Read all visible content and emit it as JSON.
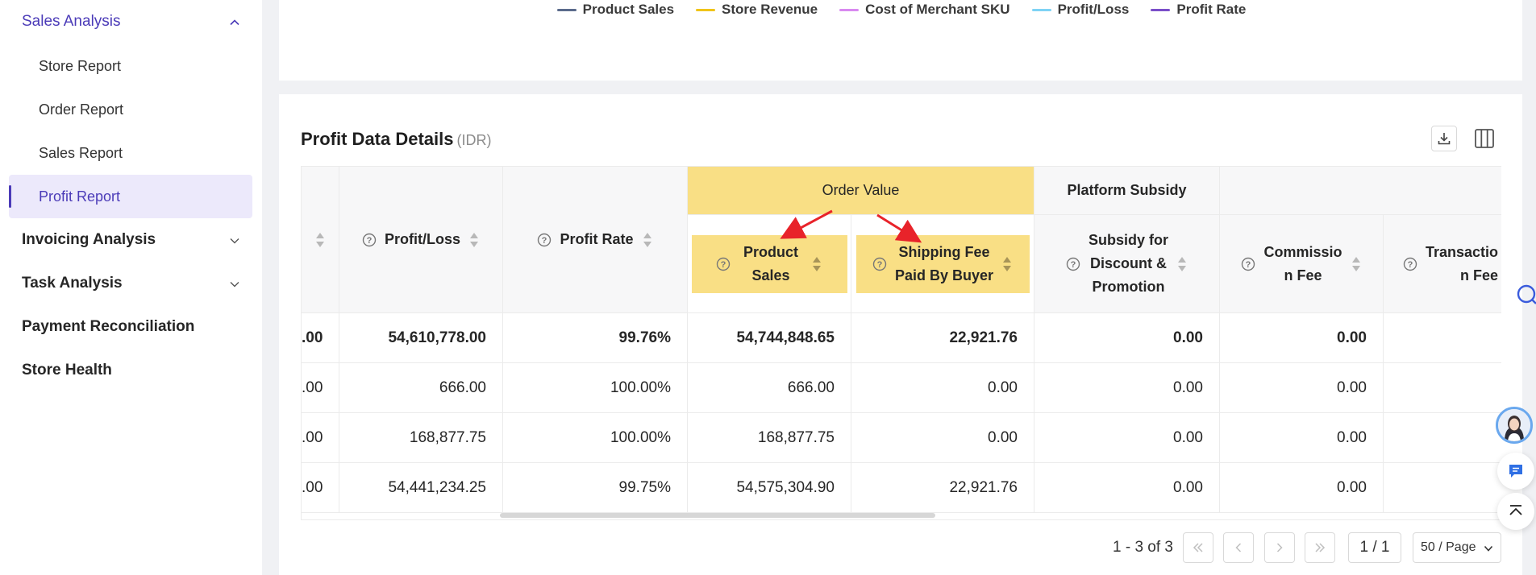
{
  "sidebar": {
    "groups": [
      {
        "label": "Sales Analysis",
        "expanded": true,
        "sub": [
          "Store Report",
          "Order Report",
          "Sales Report",
          "Profit Report"
        ],
        "selected": "Profit Report"
      },
      {
        "label": "Invoicing Analysis",
        "expanded": false
      },
      {
        "label": "Task Analysis",
        "expanded": false
      },
      {
        "label": "Payment Reconciliation"
      },
      {
        "label": "Store Health"
      }
    ]
  },
  "legend": {
    "items": [
      {
        "label": "Product Sales",
        "color": "#5b6b8c"
      },
      {
        "label": "Store Revenue",
        "color": "#f0c419"
      },
      {
        "label": "Cost of Merchant SKU",
        "color": "#d98af0"
      },
      {
        "label": "Profit/Loss",
        "color": "#7fd3f5"
      },
      {
        "label": "Profit Rate",
        "color": "#7b4fc9"
      }
    ]
  },
  "details": {
    "title": "Profit Data Details",
    "unit": "(IDR)",
    "group_headers": {
      "order_value": "Order Value",
      "platform_subsidy": "Platform Subsidy"
    },
    "columns": {
      "profit_loss": "Profit/Loss",
      "profit_rate": "Profit Rate",
      "product_sales_l1": "Product",
      "product_sales_l2": "Sales",
      "shipping_l1": "Shipping Fee",
      "shipping_l2": "Paid By Buyer",
      "subsidy_l1": "Subsidy for",
      "subsidy_l2": "Discount &",
      "subsidy_l3": "Promotion",
      "commission_l1": "Commissio",
      "commission_l2": "n Fee",
      "transaction_l1": "Transactio",
      "transaction_l2": "n Fee"
    },
    "rows": [
      {
        "first": ".00",
        "profit_loss": "54,610,778.00",
        "profit_rate": "99.76%",
        "product_sales": "54,744,848.65",
        "shipping": "22,921.76",
        "subsidy": "0.00",
        "commission": "0.00",
        "bold": true
      },
      {
        "first": ".00",
        "profit_loss": "666.00",
        "profit_rate": "100.00%",
        "product_sales": "666.00",
        "shipping": "0.00",
        "subsidy": "0.00",
        "commission": "0.00",
        "bold": false
      },
      {
        "first": ".00",
        "profit_loss": "168,877.75",
        "profit_rate": "100.00%",
        "product_sales": "168,877.75",
        "shipping": "0.00",
        "subsidy": "0.00",
        "commission": "0.00",
        "bold": false
      },
      {
        "first": ".00",
        "profit_loss": "54,441,234.25",
        "profit_rate": "99.75%",
        "product_sales": "54,575,304.90",
        "shipping": "22,921.76",
        "subsidy": "0.00",
        "commission": "0.00",
        "bold": false
      }
    ]
  },
  "pagination": {
    "range": "1 - 3 of 3",
    "page": "1 / 1",
    "page_size": "50 / Page"
  },
  "colors": {
    "accent": "#4b3bb8",
    "highlight": "#f9df85",
    "annotation_arrow": "#e8232a"
  }
}
